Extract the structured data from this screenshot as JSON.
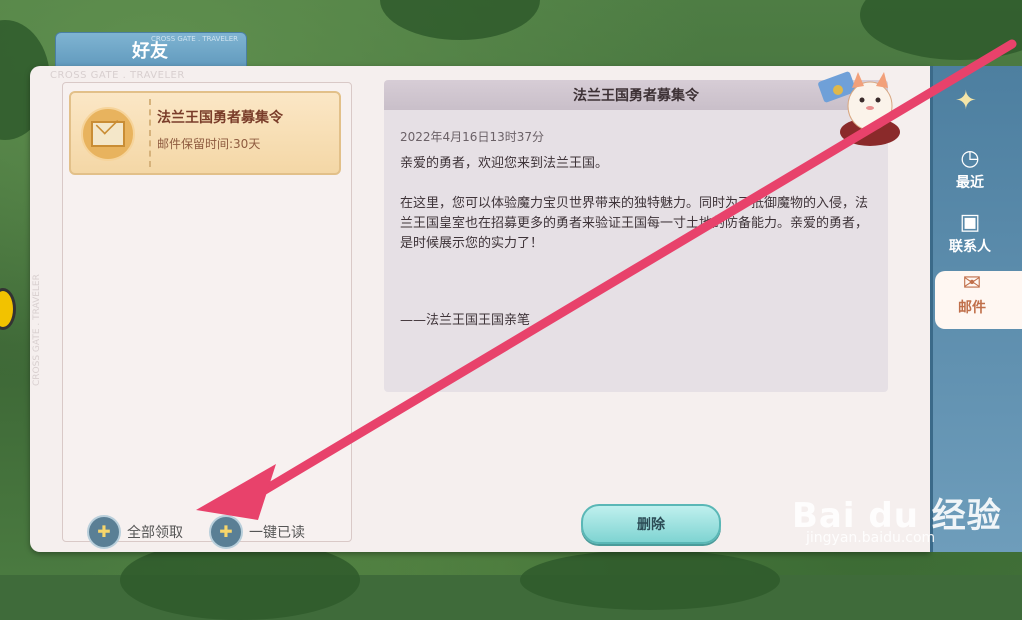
{
  "window": {
    "title": "好友",
    "title_sub": "CROSS GATE . TRAVELER",
    "brand": "CROSS GATE . TRAVELER",
    "vertical_brand": "CROSS GATE . TRAVELER"
  },
  "mail_list": {
    "items": [
      {
        "title": "法兰王国勇者募集令",
        "keep_time": "邮件保留时间:30天",
        "icon": "envelope-icon"
      }
    ],
    "claim_all_label": "全部领取",
    "read_all_label": "一键已读"
  },
  "detail": {
    "header": "法兰王国勇者募集令",
    "date": "2022年4月16日13时37分",
    "greeting": "亲爱的勇者，欢迎您来到法兰王国。",
    "body": "在这里，您可以体验魔力宝贝世界带来的独特魅力。同时为了抵御魔物的入侵，法兰王国皇室也在招募更多的勇者来验证王国每一寸土地的防备能力。亲爱的勇者，是时候展示您的实力了！",
    "signature": "——法兰王国王国亲笔",
    "delete_label": "删除"
  },
  "sidebar": {
    "items": [
      {
        "label": "最近",
        "icon": "clock-icon"
      },
      {
        "label": "联系人",
        "icon": "contact-icon"
      },
      {
        "label": "邮件",
        "icon": "mail-icon"
      }
    ],
    "active": "邮件"
  },
  "watermark": {
    "brand": "Bai du 经验",
    "url": "jingyan.baidu.com"
  },
  "colors": {
    "annotation_arrow": "#e8426b",
    "sidebar": "#5b8cad",
    "accent_button": "#7fd4d2"
  }
}
